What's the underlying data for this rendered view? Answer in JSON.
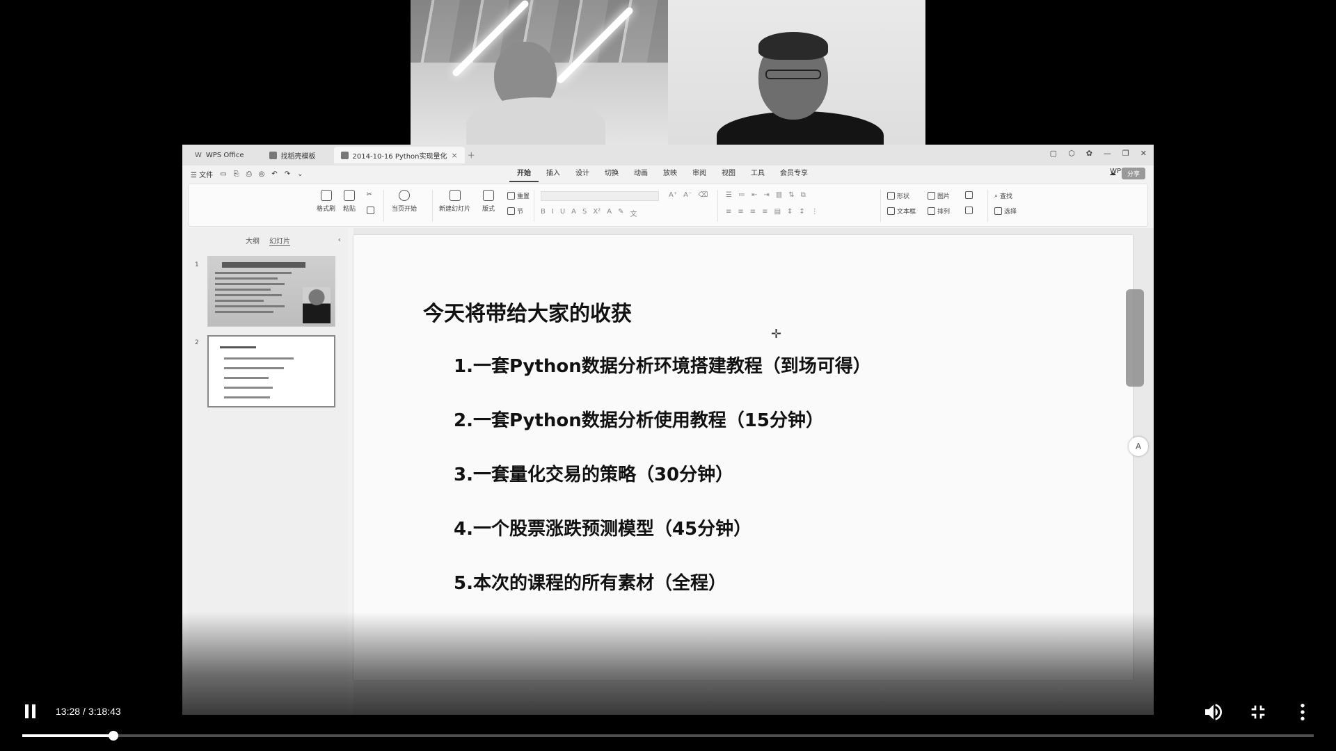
{
  "video": {
    "current_time": "13:28",
    "duration": "3:18:43",
    "progress_fraction": 0.0706
  },
  "wps": {
    "tabs": [
      {
        "label": "WPS Office"
      },
      {
        "label": "找稻壳模板"
      },
      {
        "label": "2014-10-16 Python实现量化"
      }
    ],
    "menu_left": {
      "file": "☰ 文件"
    },
    "menu_tabs": [
      "开始",
      "插入",
      "设计",
      "切换",
      "动画",
      "放映",
      "审阅",
      "视图",
      "工具",
      "会员专享"
    ],
    "active_menu_tab": "开始",
    "wps_ai": "WPS AI",
    "share": "分享",
    "ribbon": {
      "format_painter": "格式刷",
      "paste": "粘贴",
      "from_current": "当页开始",
      "new_slide": "新建幻灯片",
      "layout": "版式",
      "reset": "重置",
      "section": "节",
      "shape": "形状",
      "picture": "图片",
      "textbox": "文本框",
      "arrange": "排列",
      "find": "查找",
      "select": "选择"
    },
    "panel": {
      "outline_tab": "大纲",
      "slides_tab": "幻灯片",
      "slide_numbers": [
        "1",
        "2"
      ]
    },
    "slide": {
      "title": "今天将带给大家的收获",
      "items": [
        "1.一套Python数据分析环境搭建教程（到场可得）",
        "2.一套Python数据分析使用教程（15分钟）",
        "3.一套量化交易的策略（30分钟）",
        "4.一个股票涨跌预测模型（45分钟）",
        "5.本次的课程的所有素材（全程）"
      ]
    }
  }
}
